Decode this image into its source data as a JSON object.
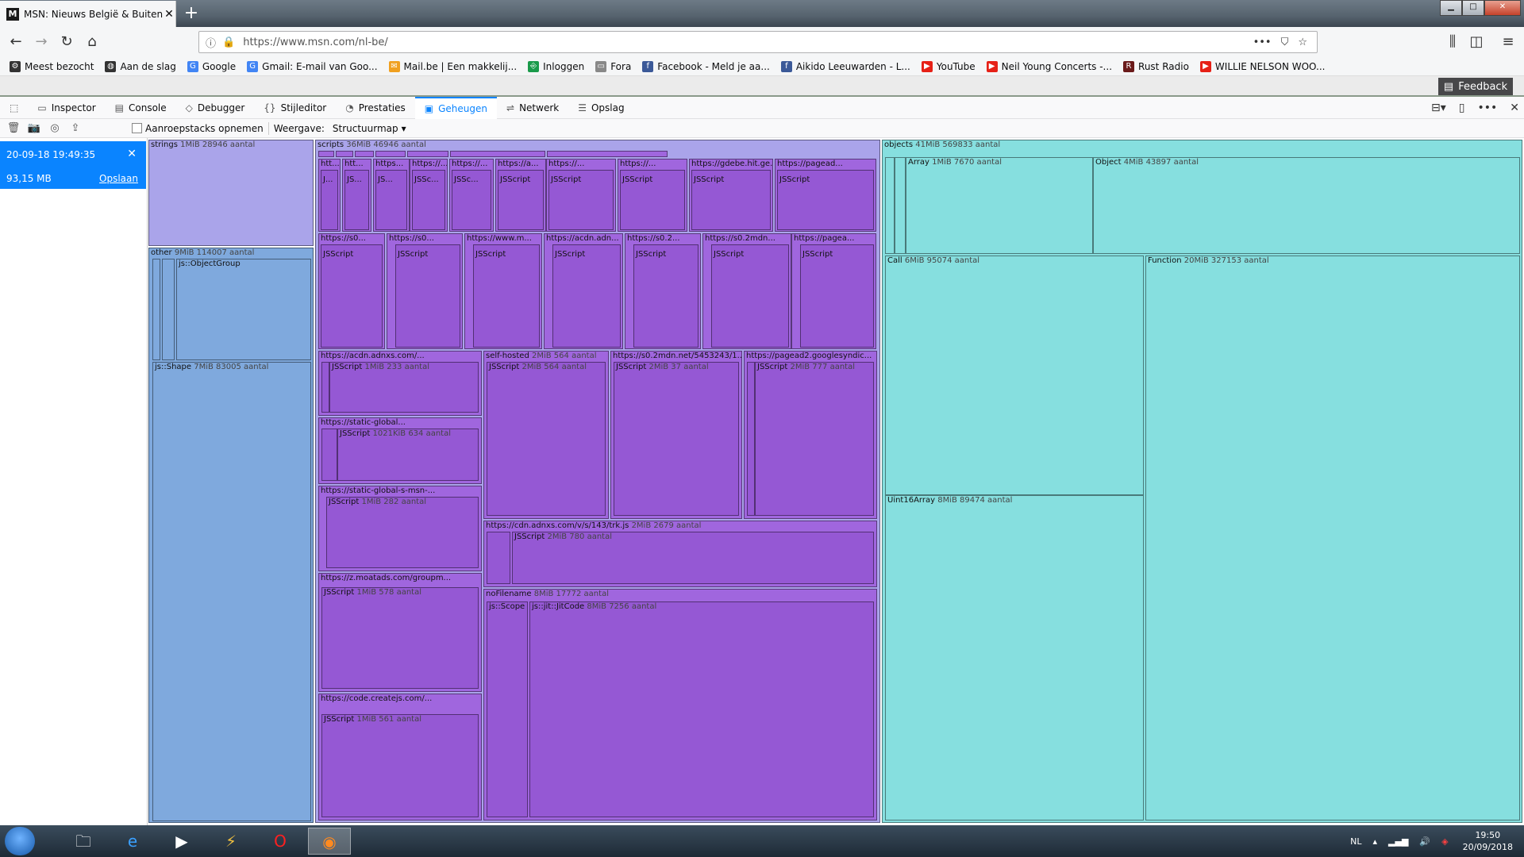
{
  "browser": {
    "tab_title": "MSN: Nieuws België & Buitenl",
    "favicon_letter": "M",
    "url": "https://www.msn.com/nl-be/",
    "bookmarks": [
      {
        "label": "Meest bezocht",
        "icon": "gear-icon",
        "color": "#333333"
      },
      {
        "label": "Aan de slag",
        "icon": "globe-icon",
        "color": "#333333"
      },
      {
        "label": "Google",
        "icon": "google-icon",
        "color": "#4285f4"
      },
      {
        "label": "Gmail: E-mail van Goo...",
        "icon": "google-icon",
        "color": "#4285f4"
      },
      {
        "label": "Mail.be | Een makkelij...",
        "icon": "mail-icon",
        "color": "#f0a020"
      },
      {
        "label": "Inloggen",
        "icon": "login-icon",
        "color": "#1a9a4a"
      },
      {
        "label": "Fora",
        "icon": "folder-icon",
        "color": "#888888"
      },
      {
        "label": "Facebook - Meld je aa...",
        "icon": "facebook-icon",
        "color": "#3b5998"
      },
      {
        "label": "Aikido Leeuwarden - L...",
        "icon": "facebook-icon",
        "color": "#3b5998"
      },
      {
        "label": "YouTube",
        "icon": "youtube-icon",
        "color": "#e62117"
      },
      {
        "label": "Neil Young Concerts -...",
        "icon": "youtube-icon",
        "color": "#e62117"
      },
      {
        "label": "Rust Radio",
        "icon": "radio-icon",
        "color": "#6a1a1a"
      },
      {
        "label": "WILLIE NELSON WOO...",
        "icon": "youtube-icon",
        "color": "#e62117"
      }
    ],
    "feedback_label": "Feedback"
  },
  "devtools": {
    "tabs": [
      {
        "label": "Inspector",
        "icon": "▭"
      },
      {
        "label": "Console",
        "icon": "▤"
      },
      {
        "label": "Debugger",
        "icon": "◇"
      },
      {
        "label": "Stijleditor",
        "icon": "{}"
      },
      {
        "label": "Prestaties",
        "icon": "◔"
      },
      {
        "label": "Geheugen",
        "icon": "▣"
      },
      {
        "label": "Netwerk",
        "icon": "⇌"
      },
      {
        "label": "Opslag",
        "icon": "☰"
      }
    ],
    "selected_tab": "Geheugen"
  },
  "memory_toolbar": {
    "record_label": "Aanroepstacks opnemen",
    "view_label": "Weergave:",
    "view_value": "Structuurmap"
  },
  "snapshot": {
    "date": "20-09-18 19:49:35",
    "size": "93,15 MB",
    "save_label": "Opslaan"
  },
  "treemap_labels": {
    "strings": {
      "name": "strings",
      "meta": "1MiB 28946 aantal"
    },
    "other": {
      "name": "other",
      "meta": "9MiB 114007 aantal"
    },
    "objectgroup": {
      "name": "js::ObjectGroup",
      "meta": ""
    },
    "shape": {
      "name": "js::Shape",
      "meta": "7MiB 83005 aantal"
    },
    "scripts": {
      "name": "scripts",
      "meta": "36MiB 46946 aantal"
    },
    "objects": {
      "name": "objects",
      "meta": "41MiB 569833 aantal"
    },
    "array": {
      "name": "Array",
      "meta": "1MiB 7670 aantal"
    },
    "object": {
      "name": "Object",
      "meta": "4MiB 43897 aantal"
    },
    "call": {
      "name": "Call",
      "meta": "6MiB 95074 aantal"
    },
    "function": {
      "name": "Function",
      "meta": "20MiB 327153 aantal"
    },
    "uint16": {
      "name": "Uint16Array",
      "meta": "8MiB 89474 aantal"
    },
    "acdn1": {
      "name": "https://acdn.adnxs.com/...",
      "meta": ""
    },
    "acdn1js": {
      "name": "JSScript",
      "meta": "1MiB 233 aantal"
    },
    "static1": {
      "name": "https://static-global...",
      "meta": ""
    },
    "static1js": {
      "name": "JSScript",
      "meta": "1021KiB 634 aantal"
    },
    "static2": {
      "name": "https://static-global-s-msn-...",
      "meta": ""
    },
    "static2js": {
      "name": "JSScript",
      "meta": "1MiB 282 aantal"
    },
    "moat": {
      "name": "https://z.moatads.com/groupm...",
      "meta": ""
    },
    "moatjs": {
      "name": "JSScript",
      "meta": "1MiB 578 aantal"
    },
    "create": {
      "name": "https://code.createjs.com/...",
      "meta": ""
    },
    "createjs": {
      "name": "JSScript",
      "meta": "1MiB 561 aantal"
    },
    "selfhosted": {
      "name": "self-hosted",
      "meta": "2MiB 564 aantal"
    },
    "selfhostedjs": {
      "name": "JSScript",
      "meta": "2MiB 564 aantal"
    },
    "s0mdn": {
      "name": "https://s0.2mdn.net/5453243/1...",
      "meta": ""
    },
    "s0mdnjs": {
      "name": "JSScript",
      "meta": "2MiB 37 aantal"
    },
    "pagead2": {
      "name": "https://pagead2.googlesyndic...",
      "meta": ""
    },
    "pagead2js": {
      "name": "JSScript",
      "meta": "2MiB 777 aantal"
    },
    "trk": {
      "name": "https://cdn.adnxs.com/v/s/143/trk.js",
      "meta": "2MiB 2679 aantal"
    },
    "trkjs": {
      "name": "JSScript",
      "meta": "2MiB 780 aantal"
    },
    "nofile": {
      "name": "noFilename",
      "meta": "8MiB 17772 aantal"
    },
    "scope": {
      "name": "js::Scope",
      "meta": ""
    },
    "jitcode": {
      "name": "js::jit::JitCode",
      "meta": "8MiB 7256 aantal"
    },
    "r2": [
      {
        "name": "https://s0...",
        "meta": ""
      },
      {
        "name": "https://s0...",
        "meta": ""
      },
      {
        "name": "https://www.m...",
        "meta": ""
      },
      {
        "name": "https://acdn.adn...",
        "meta": ""
      },
      {
        "name": "https://s0.2...",
        "meta": ""
      },
      {
        "name": "https://s0.2mdn...",
        "meta": ""
      },
      {
        "name": "https://pagea...",
        "meta": ""
      }
    ],
    "r1": [
      {
        "name": "htt...",
        "meta": ""
      },
      {
        "name": "htt...",
        "meta": ""
      },
      {
        "name": "https...",
        "meta": ""
      },
      {
        "name": "https://...",
        "meta": ""
      },
      {
        "name": "https://...",
        "meta": ""
      },
      {
        "name": "https://a...",
        "meta": ""
      },
      {
        "name": "https://...",
        "meta": ""
      },
      {
        "name": "https://...",
        "meta": ""
      },
      {
        "name": "https://gdebe.hit.ge...",
        "meta": ""
      },
      {
        "name": "https://pagead...",
        "meta": ""
      }
    ],
    "jss": "JSScript",
    "jsabbr": [
      "J...",
      "JS...",
      "JS...",
      "JSSc...",
      "JSSc...",
      "j...",
      "js..."
    ]
  },
  "taskbar": {
    "lang": "NL",
    "time": "19:50",
    "date": "20/09/2018"
  }
}
